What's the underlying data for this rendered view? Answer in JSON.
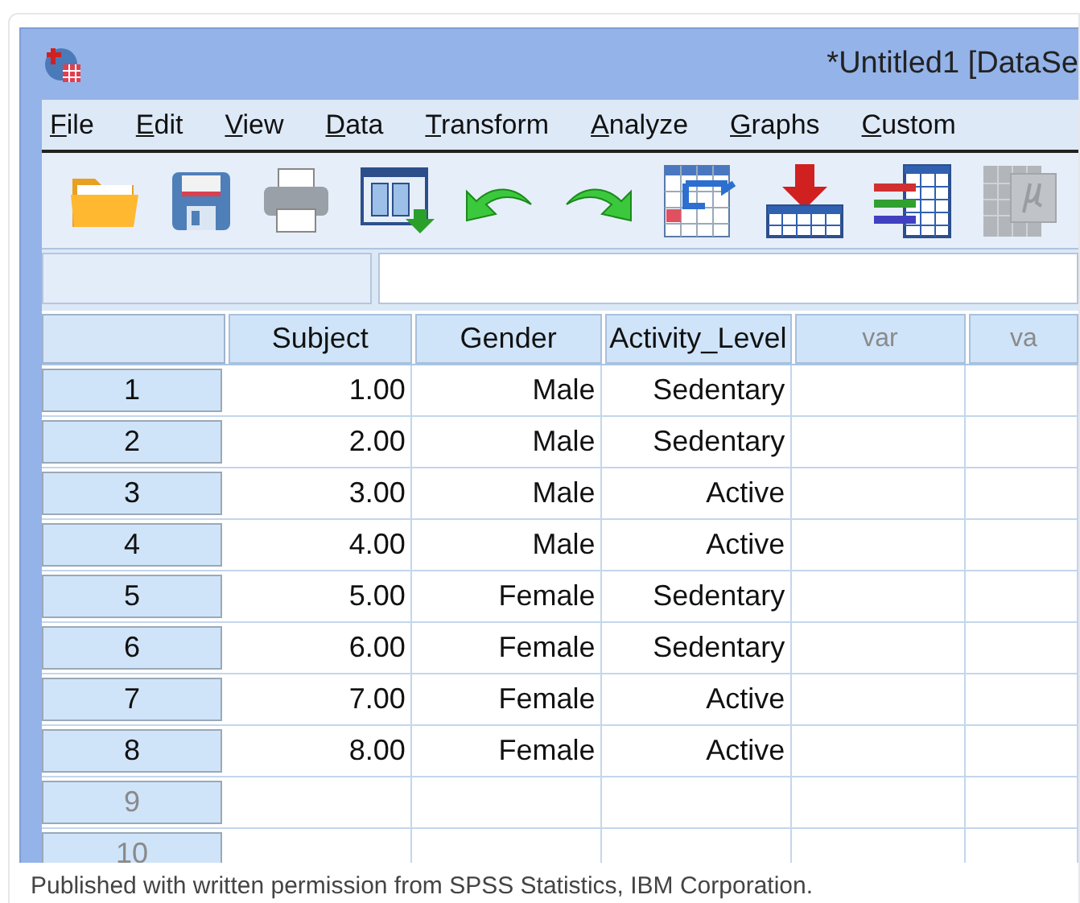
{
  "window": {
    "title": "*Untitled1 [DataSe"
  },
  "menu": [
    {
      "label": "File"
    },
    {
      "label": "Edit"
    },
    {
      "label": "View"
    },
    {
      "label": "Data"
    },
    {
      "label": "Transform"
    },
    {
      "label": "Analyze"
    },
    {
      "label": "Graphs"
    },
    {
      "label": "Custom"
    }
  ],
  "toolbar": [
    {
      "kind": "open",
      "disabled": false
    },
    {
      "kind": "save",
      "disabled": false
    },
    {
      "kind": "print",
      "disabled": false
    },
    {
      "kind": "dialog",
      "disabled": false
    },
    {
      "kind": "undo",
      "disabled": false
    },
    {
      "kind": "redo",
      "disabled": false
    },
    {
      "kind": "goto",
      "disabled": false
    },
    {
      "kind": "insert",
      "disabled": false
    },
    {
      "kind": "variables",
      "disabled": false
    },
    {
      "kind": "stats",
      "disabled": true
    }
  ],
  "table": {
    "columns": [
      {
        "label": "Subject",
        "disabled": false
      },
      {
        "label": "Gender",
        "disabled": false
      },
      {
        "label": "Activity_Level",
        "disabled": false
      },
      {
        "label": "var",
        "disabled": true
      },
      {
        "label": "va",
        "disabled": true
      }
    ],
    "rows": [
      {
        "label": "1",
        "disabled": false,
        "cells": [
          "1.00",
          "Male",
          "Sedentary"
        ]
      },
      {
        "label": "2",
        "disabled": false,
        "cells": [
          "2.00",
          "Male",
          "Sedentary"
        ]
      },
      {
        "label": "3",
        "disabled": false,
        "cells": [
          "3.00",
          "Male",
          "Active"
        ]
      },
      {
        "label": "4",
        "disabled": false,
        "cells": [
          "4.00",
          "Male",
          "Active"
        ]
      },
      {
        "label": "5",
        "disabled": false,
        "cells": [
          "5.00",
          "Female",
          "Sedentary"
        ]
      },
      {
        "label": "6",
        "disabled": false,
        "cells": [
          "6.00",
          "Female",
          "Sedentary"
        ]
      },
      {
        "label": "7",
        "disabled": false,
        "cells": [
          "7.00",
          "Female",
          "Active"
        ]
      },
      {
        "label": "8",
        "disabled": false,
        "cells": [
          "8.00",
          "Female",
          "Active"
        ]
      },
      {
        "label": "9",
        "disabled": true,
        "cells": []
      },
      {
        "label": "10",
        "disabled": true,
        "cells": []
      }
    ]
  },
  "caption": "Published with written permission from SPSS Statistics, IBM Corporation."
}
